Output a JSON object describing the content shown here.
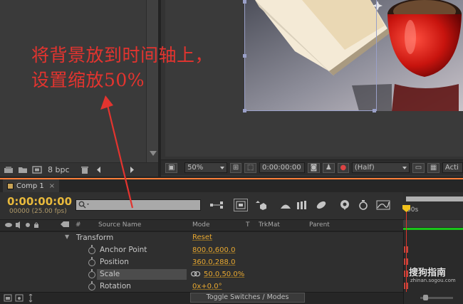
{
  "annotation": {
    "line1": "将背景放到时间轴上，",
    "line2": "设置缩放50%"
  },
  "project": {
    "bpc_label": "8 bpc",
    "icons": [
      "interpret-footage-icon",
      "new-folder-icon",
      "new-composition-icon",
      "delete-icon",
      "arrow-left-icon",
      "arrow-right-icon"
    ]
  },
  "viewer": {
    "zoom": "50%",
    "timecode": "0:00:00:00",
    "resolution": "(Half)",
    "trailing_label": "Acti"
  },
  "timeline": {
    "tab_label": "Comp 1",
    "tab_close": "×",
    "timecode": "0:00:00:00",
    "timecode_sub": "00000 (25.00 fps)",
    "search_placeholder": "",
    "columns": {
      "number": "#",
      "source_name": "Source Name",
      "mode": "Mode",
      "t": "T",
      "trkmat": "TrkMat",
      "parent": "Parent"
    },
    "group": {
      "name": "Transform",
      "action": "Reset"
    },
    "properties": [
      {
        "name": "Anchor Point",
        "value": "800.0,600.0"
      },
      {
        "name": "Position",
        "value": "360.0,288.0"
      },
      {
        "name": "Scale",
        "value": "50.0,50.0%"
      },
      {
        "name": "Rotation",
        "value": "0x+0.0°"
      }
    ],
    "toggle_button": "Toggle Switches / Modes",
    "ruler_label": "00s"
  },
  "watermark": {
    "brand": "搜狗指南",
    "url": "zhinan.sogou.com"
  },
  "colors": {
    "annotation": "#e3342f",
    "timecode": "#e8b93c",
    "property_value": "#e8a830",
    "playhead": "#f2c21c",
    "accent_tab": "#ff7f3a"
  }
}
